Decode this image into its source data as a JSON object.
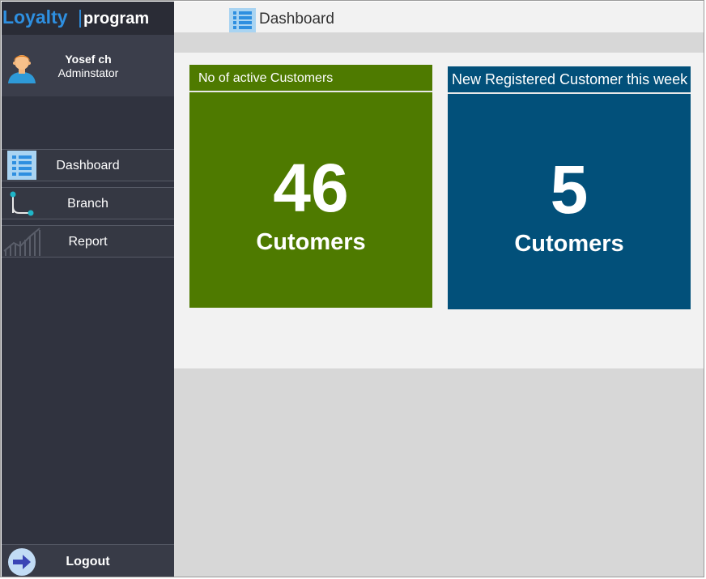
{
  "brand": {
    "name_a": "Loyalty",
    "separator": "|",
    "name_b": "program"
  },
  "user": {
    "name": "Yosef ch",
    "role": "Adminstator",
    "avatar_icon": "user-avatar-icon"
  },
  "nav": [
    {
      "label": "Dashboard",
      "icon": "list-icon"
    },
    {
      "label": "Branch",
      "icon": "branch-icon"
    },
    {
      "label": "Report",
      "icon": "chart-icon"
    }
  ],
  "logout": {
    "label": "Logout",
    "icon": "arrow-right-icon"
  },
  "header": {
    "title": "Dashboard",
    "icon": "list-icon"
  },
  "cards": [
    {
      "title": "No of active Customers",
      "value": "46",
      "unit": "Cutomers",
      "color": "#4e7a00"
    },
    {
      "title": "New Registered Customer this week",
      "value": "5",
      "unit": "Cutomers",
      "color": "#02507a"
    }
  ],
  "colors": {
    "sidebar": "#30333f",
    "brand_blue": "#2e8fe0",
    "icon_blue": "#2e8fe0"
  }
}
